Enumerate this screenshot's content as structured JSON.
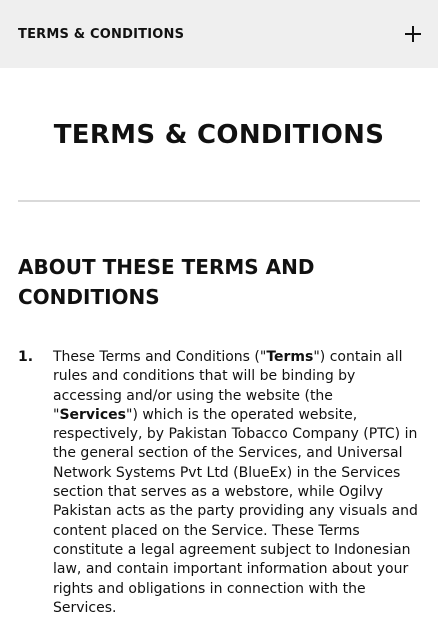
{
  "header": {
    "title": "TERMS & CONDITIONS",
    "toggle_icon": "plus-icon"
  },
  "main": {
    "title": "TERMS & CONDITIONS",
    "section_heading": "ABOUT THESE TERMS AND CONDITIONS",
    "items": [
      {
        "number": "1.",
        "text_1": "These Terms and Conditions (\"",
        "bold_1": "Terms",
        "text_2": "\") contain all rules and conditions that will be binding by accessing and/or using the website (the \"",
        "bold_2": "Services",
        "text_3": "\") which is the operated website, respectively, by Pakistan Tobacco Company (PTC) in the general section of the Services, and Universal Network Systems Pvt Ltd (BlueEx) in the Services section that serves as a webstore, while Ogilvy Pakistan acts as the party providing any visuals and content placed on the Service. These Terms constitute a legal agreement subject to Indonesian law, and contain important information about your rights and obligations in connection with the Services."
      }
    ]
  }
}
